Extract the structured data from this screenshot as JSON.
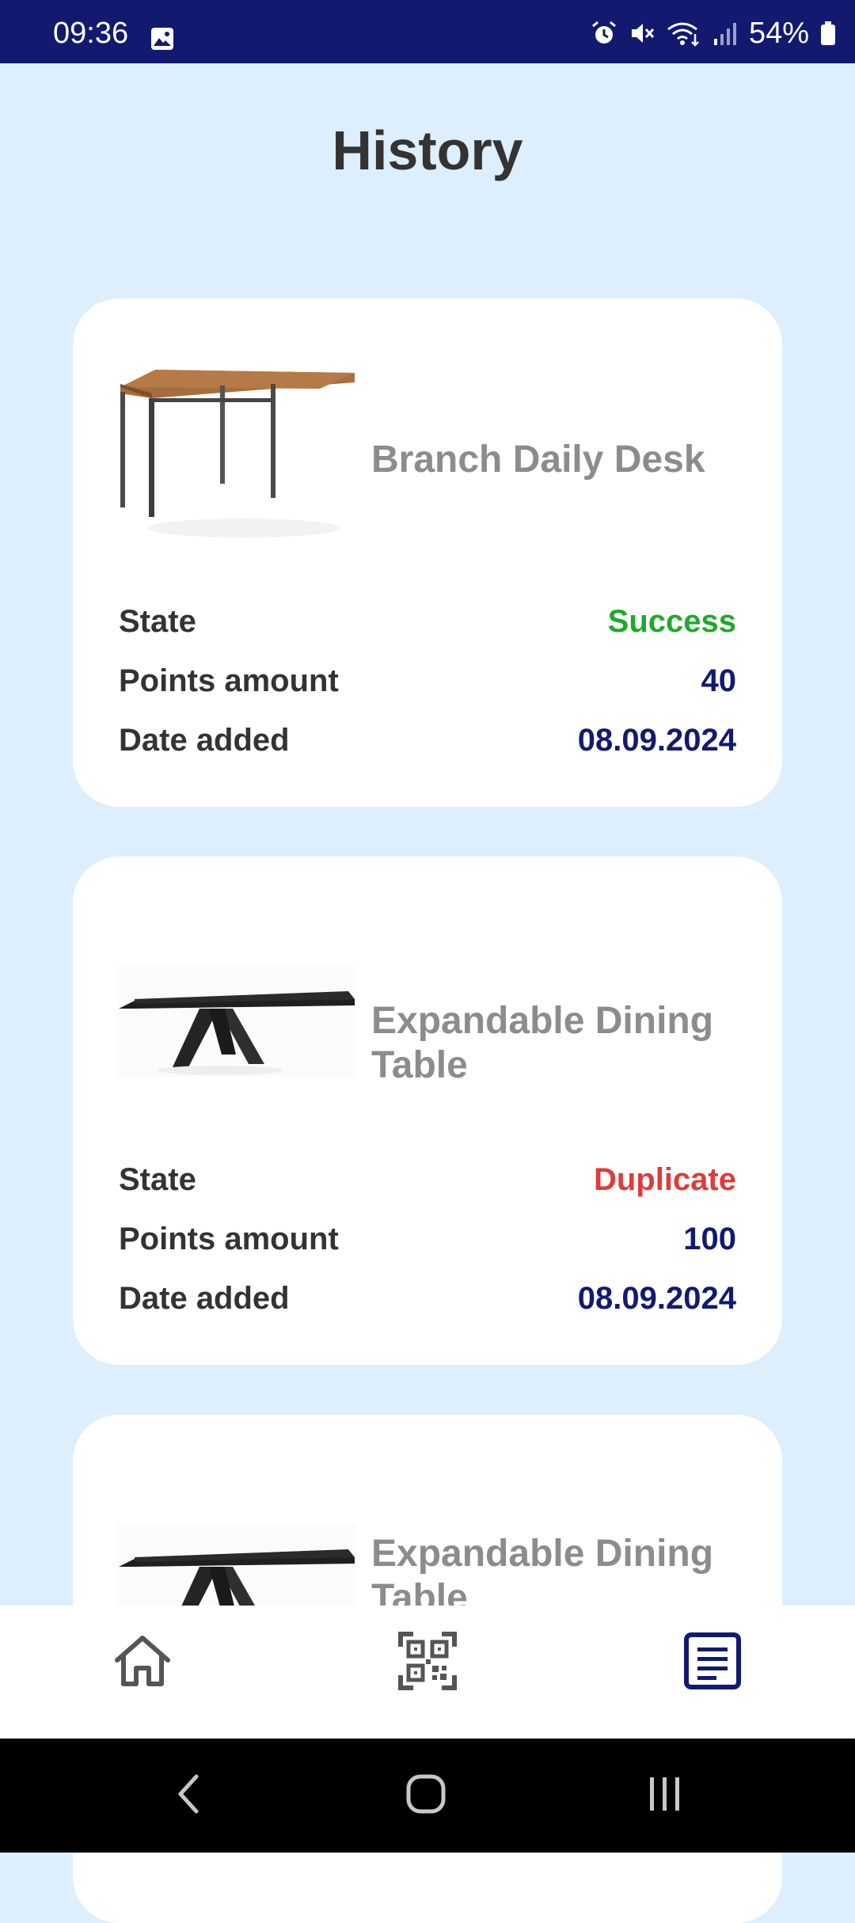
{
  "status_bar": {
    "time": "09:36",
    "battery": "54%",
    "icons": [
      "image-icon",
      "alarm-icon",
      "mute-icon",
      "wifi-icon",
      "signal-icon",
      "battery-icon"
    ]
  },
  "page": {
    "title": "History"
  },
  "history": [
    {
      "name": "Branch Daily Desk",
      "image": "desk-image",
      "state_label": "State",
      "state": "Success",
      "state_color": "#1faa2c",
      "points_label": "Points amount",
      "points": "40",
      "date_label": "Date added",
      "date": "08.09.2024"
    },
    {
      "name": "Expandable Dining Table",
      "image": "dining-table-image",
      "state_label": "State",
      "state": "Duplicate",
      "state_color": "#e03a3a",
      "points_label": "Points amount",
      "points": "100",
      "date_label": "Date added",
      "date": "08.09.2024"
    },
    {
      "name": "Expandable Dining Table",
      "image": "dining-table-image"
    }
  ],
  "bottom_nav": {
    "items": [
      {
        "icon": "home-icon",
        "active": false
      },
      {
        "icon": "qr-code-icon",
        "active": false
      },
      {
        "icon": "history-list-icon",
        "active": true
      }
    ],
    "active_color": "#121a70",
    "inactive_color": "#555555"
  },
  "system_nav": {
    "icons": [
      "back-icon",
      "home-circle-icon",
      "recent-apps-icon"
    ]
  },
  "colors": {
    "background": "#ddeefd",
    "status_bar": "#121a70",
    "value_text": "#121a70",
    "label_text": "#333333",
    "product_name": "#8c8c8c"
  }
}
